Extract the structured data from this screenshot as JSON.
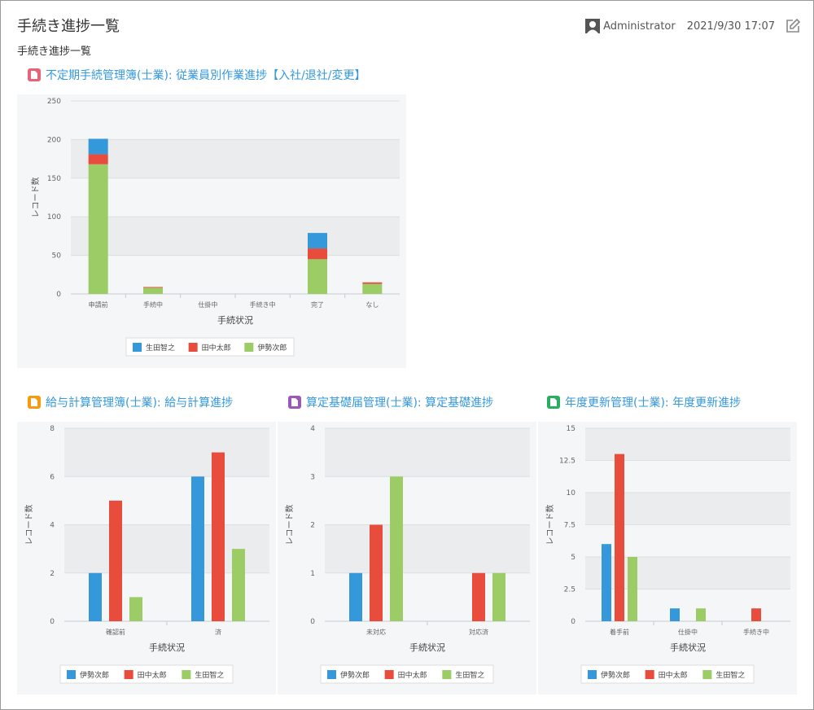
{
  "header": {
    "title": "手続き進捗一覧",
    "username": "Administrator",
    "datetime": "2021/9/30 17:07"
  },
  "subtitle": "手続き進捗一覧",
  "colors": {
    "link": "#3498db",
    "blue": "#3498db",
    "red": "#e74c3c",
    "green": "#9ccc65",
    "panel_bg": "#f4f6f7",
    "band": "#eaecee"
  },
  "charts": [
    {
      "title": "不定期手続管理簿(士業): 従業員別作業進捗【入社/退社/変更】",
      "icon": "pink-app-icon",
      "icon_color": "#e8637a",
      "chart_data": {
        "type": "bar",
        "stacked": true,
        "categories": [
          "申請前",
          "手続中",
          "仕掛中",
          "手続き中",
          "完了",
          "なし"
        ],
        "xlabel": "手続状況",
        "ylabel": "レコード数",
        "ylim": [
          0,
          250
        ],
        "yticks": [
          0,
          50,
          100,
          150,
          200,
          250
        ],
        "series": [
          {
            "name": "伊勢次郎",
            "color": "#9ccc65",
            "values": [
              168,
              8,
              0,
              0,
              45,
              13
            ]
          },
          {
            "name": "田中太郎",
            "color": "#e74c3c",
            "values": [
              13,
              1,
              0,
              0,
              14,
              2
            ]
          },
          {
            "name": "生田智之",
            "color": "#3498db",
            "values": [
              20,
              0,
              0,
              0,
              20,
              0
            ]
          }
        ],
        "legend": [
          "生田智之",
          "田中太郎",
          "伊勢次郎"
        ],
        "legend_colors": [
          "#3498db",
          "#e74c3c",
          "#9ccc65"
        ],
        "grid": true,
        "legend_position": "bottom"
      }
    },
    {
      "title": "給与計算管理簿(士業): 給与計算進捗",
      "icon": "orange-app-icon",
      "icon_color": "#f39c12",
      "chart_data": {
        "type": "bar",
        "stacked": false,
        "categories": [
          "確認前",
          "済"
        ],
        "xlabel": "手続状況",
        "ylabel": "レコード数",
        "ylim": [
          0,
          8
        ],
        "yticks": [
          0,
          2,
          4,
          6,
          8
        ],
        "series": [
          {
            "name": "伊勢次郎",
            "color": "#3498db",
            "values": [
              2,
              6
            ]
          },
          {
            "name": "田中太郎",
            "color": "#e74c3c",
            "values": [
              5,
              7
            ]
          },
          {
            "name": "生田智之",
            "color": "#9ccc65",
            "values": [
              1,
              3
            ]
          }
        ],
        "legend": [
          "伊勢次郎",
          "田中太郎",
          "生田智之"
        ],
        "legend_colors": [
          "#3498db",
          "#e74c3c",
          "#9ccc65"
        ],
        "grid": true,
        "legend_position": "bottom"
      }
    },
    {
      "title": "算定基礎届管理(士業): 算定基礎進捗",
      "icon": "purple-app-icon",
      "icon_color": "#9b59b6",
      "chart_data": {
        "type": "bar",
        "stacked": false,
        "categories": [
          "未対応",
          "対応済"
        ],
        "xlabel": "手続状況",
        "ylabel": "レコード数",
        "ylim": [
          0,
          4
        ],
        "yticks": [
          0,
          1,
          2,
          3,
          4
        ],
        "series": [
          {
            "name": "伊勢次郎",
            "color": "#3498db",
            "values": [
              1,
              0
            ]
          },
          {
            "name": "田中太郎",
            "color": "#e74c3c",
            "values": [
              2,
              1
            ]
          },
          {
            "name": "生田智之",
            "color": "#9ccc65",
            "values": [
              3,
              1
            ]
          }
        ],
        "legend": [
          "伊勢次郎",
          "田中太郎",
          "生田智之"
        ],
        "legend_colors": [
          "#3498db",
          "#e74c3c",
          "#9ccc65"
        ],
        "grid": true,
        "legend_position": "bottom"
      }
    },
    {
      "title": "年度更新管理(士業): 年度更新進捗",
      "icon": "green-app-icon",
      "icon_color": "#27ae60",
      "chart_data": {
        "type": "bar",
        "stacked": false,
        "categories": [
          "着手前",
          "仕掛中",
          "手続き中"
        ],
        "xlabel": "手続状況",
        "ylabel": "レコード数",
        "ylim": [
          0,
          15
        ],
        "yticks": [
          0,
          2.5,
          5,
          7.5,
          10,
          12.5,
          15
        ],
        "series": [
          {
            "name": "伊勢次郎",
            "color": "#3498db",
            "values": [
              6,
              1,
              0
            ]
          },
          {
            "name": "田中太郎",
            "color": "#e74c3c",
            "values": [
              13,
              0,
              1
            ]
          },
          {
            "name": "生田智之",
            "color": "#9ccc65",
            "values": [
              5,
              1,
              0
            ]
          }
        ],
        "legend": [
          "伊勢次郎",
          "田中太郎",
          "生田智之"
        ],
        "legend_colors": [
          "#3498db",
          "#e74c3c",
          "#9ccc65"
        ],
        "grid": true,
        "legend_position": "bottom"
      }
    }
  ]
}
